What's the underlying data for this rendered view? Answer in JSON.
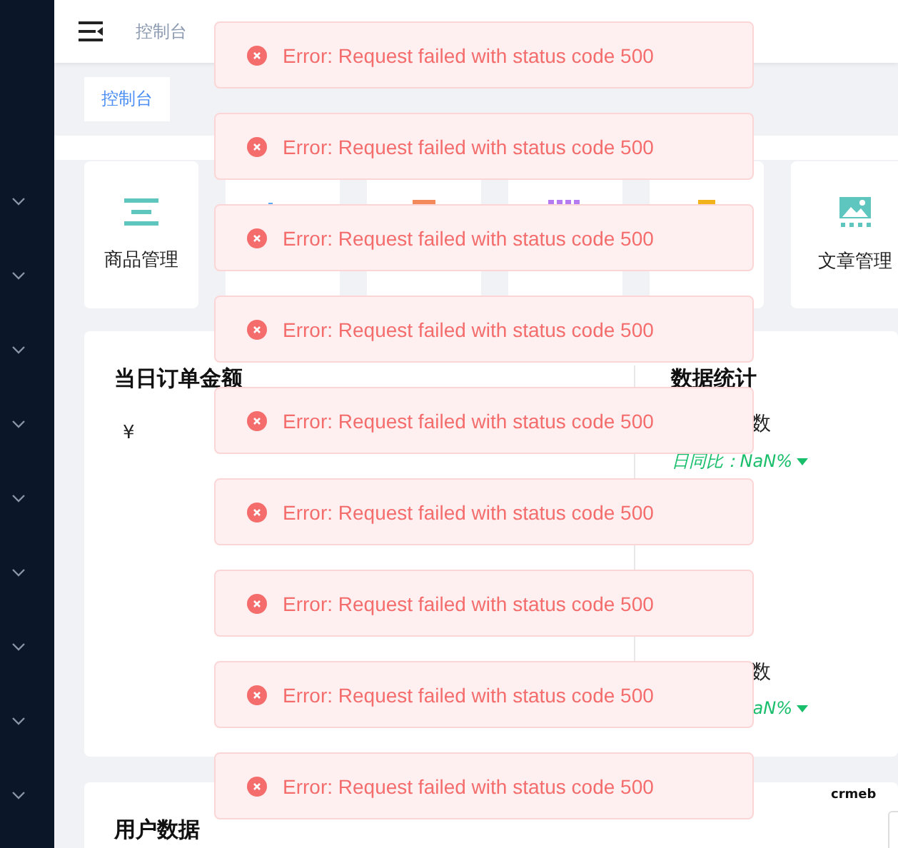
{
  "sidebar": {
    "items": [
      {
        "expanded": false
      },
      {
        "expanded": false
      },
      {
        "expanded": false
      },
      {
        "expanded": false
      },
      {
        "expanded": false
      },
      {
        "expanded": false
      },
      {
        "expanded": false
      },
      {
        "expanded": false
      },
      {
        "expanded": false
      }
    ]
  },
  "header": {
    "breadcrumb": "控制台"
  },
  "tags": [
    {
      "label": "控制台",
      "selected": true
    }
  ],
  "shortcuts": [
    {
      "kind": "list",
      "label": "商品管理"
    },
    {
      "kind": "chart"
    },
    {
      "kind": "doc"
    },
    {
      "kind": "dots"
    },
    {
      "kind": "text"
    },
    {
      "kind": "image",
      "label": "文章管理"
    }
  ],
  "order_card": {
    "title": "当日订单金额",
    "amount": "¥"
  },
  "stats": {
    "title": "数据统计",
    "items": [
      {
        "label": "数",
        "compare": "日同比：NaN%"
      },
      {
        "label": "数",
        "compare": "aN%"
      }
    ]
  },
  "user_card": {
    "title": "用户数据",
    "logo": "crmeb"
  },
  "toasts": [
    {
      "message": "Error: Request failed with status code 500"
    },
    {
      "message": "Error: Request failed with status code 500"
    },
    {
      "message": "Error: Request failed with status code 500"
    },
    {
      "message": "Error: Request failed with status code 500"
    },
    {
      "message": "Error: Request failed with status code 500"
    },
    {
      "message": "Error: Request failed with status code 500"
    },
    {
      "message": "Error: Request failed with status code 500"
    },
    {
      "message": "Error: Request failed with status code 500"
    },
    {
      "message": "Error: Request failed with status code 500"
    }
  ]
}
